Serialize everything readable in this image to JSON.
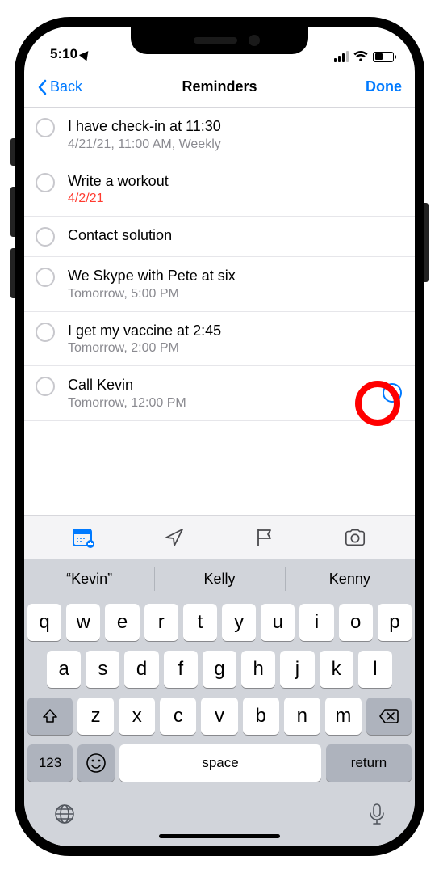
{
  "status": {
    "time": "5:10"
  },
  "nav": {
    "back": "Back",
    "title": "Reminders",
    "done": "Done"
  },
  "reminders": [
    {
      "title": "I have check-in at 11:30",
      "sub": "4/21/21, 11:00 AM, Weekly",
      "overdue": false
    },
    {
      "title": "Write a workout",
      "sub": "4/2/21",
      "overdue": true
    },
    {
      "title": "Contact solution",
      "sub": "",
      "overdue": false
    },
    {
      "title": "We Skype with Pete at six",
      "sub": "Tomorrow, 5:00 PM",
      "overdue": false
    },
    {
      "title": "I get my vaccine at 2:45",
      "sub": "Tomorrow, 2:00 PM",
      "overdue": false
    },
    {
      "title": "Call Kevin",
      "sub": "Tomorrow, 12:00 PM",
      "overdue": false,
      "showInfo": true
    }
  ],
  "quicktype": {
    "s0": "“Kevin”",
    "s1": "Kelly",
    "s2": "Kenny"
  },
  "keyboard": {
    "row1": [
      "q",
      "w",
      "e",
      "r",
      "t",
      "y",
      "u",
      "i",
      "o",
      "p"
    ],
    "row2": [
      "a",
      "s",
      "d",
      "f",
      "g",
      "h",
      "j",
      "k",
      "l"
    ],
    "row3": [
      "z",
      "x",
      "c",
      "v",
      "b",
      "n",
      "m"
    ],
    "numLabel": "123",
    "spaceLabel": "space",
    "returnLabel": "return"
  }
}
